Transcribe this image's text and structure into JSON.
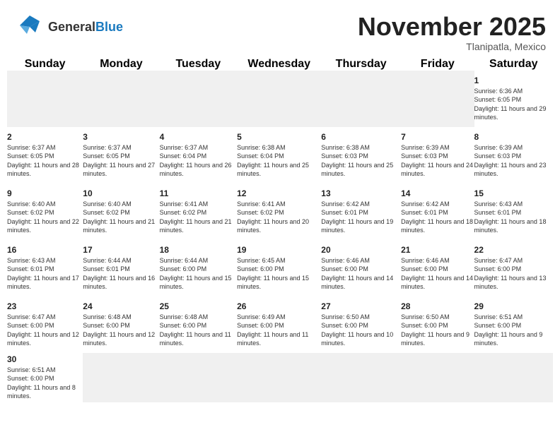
{
  "header": {
    "logo_text_general": "General",
    "logo_text_blue": "Blue",
    "month_title": "November 2025",
    "location": "Tlanipatla, Mexico"
  },
  "days_of_week": [
    "Sunday",
    "Monday",
    "Tuesday",
    "Wednesday",
    "Thursday",
    "Friday",
    "Saturday"
  ],
  "weeks": [
    [
      {
        "day": "",
        "empty": true
      },
      {
        "day": "",
        "empty": true
      },
      {
        "day": "",
        "empty": true
      },
      {
        "day": "",
        "empty": true
      },
      {
        "day": "",
        "empty": true
      },
      {
        "day": "",
        "empty": true
      },
      {
        "day": "1",
        "sunrise": "6:36 AM",
        "sunset": "6:05 PM",
        "daylight": "11 hours and 29 minutes."
      }
    ],
    [
      {
        "day": "2",
        "sunrise": "6:37 AM",
        "sunset": "6:05 PM",
        "daylight": "11 hours and 28 minutes."
      },
      {
        "day": "3",
        "sunrise": "6:37 AM",
        "sunset": "6:05 PM",
        "daylight": "11 hours and 27 minutes."
      },
      {
        "day": "4",
        "sunrise": "6:37 AM",
        "sunset": "6:04 PM",
        "daylight": "11 hours and 26 minutes."
      },
      {
        "day": "5",
        "sunrise": "6:38 AM",
        "sunset": "6:04 PM",
        "daylight": "11 hours and 25 minutes."
      },
      {
        "day": "6",
        "sunrise": "6:38 AM",
        "sunset": "6:03 PM",
        "daylight": "11 hours and 25 minutes."
      },
      {
        "day": "7",
        "sunrise": "6:39 AM",
        "sunset": "6:03 PM",
        "daylight": "11 hours and 24 minutes."
      },
      {
        "day": "8",
        "sunrise": "6:39 AM",
        "sunset": "6:03 PM",
        "daylight": "11 hours and 23 minutes."
      }
    ],
    [
      {
        "day": "9",
        "sunrise": "6:40 AM",
        "sunset": "6:02 PM",
        "daylight": "11 hours and 22 minutes."
      },
      {
        "day": "10",
        "sunrise": "6:40 AM",
        "sunset": "6:02 PM",
        "daylight": "11 hours and 21 minutes."
      },
      {
        "day": "11",
        "sunrise": "6:41 AM",
        "sunset": "6:02 PM",
        "daylight": "11 hours and 21 minutes."
      },
      {
        "day": "12",
        "sunrise": "6:41 AM",
        "sunset": "6:02 PM",
        "daylight": "11 hours and 20 minutes."
      },
      {
        "day": "13",
        "sunrise": "6:42 AM",
        "sunset": "6:01 PM",
        "daylight": "11 hours and 19 minutes."
      },
      {
        "day": "14",
        "sunrise": "6:42 AM",
        "sunset": "6:01 PM",
        "daylight": "11 hours and 18 minutes."
      },
      {
        "day": "15",
        "sunrise": "6:43 AM",
        "sunset": "6:01 PM",
        "daylight": "11 hours and 18 minutes."
      }
    ],
    [
      {
        "day": "16",
        "sunrise": "6:43 AM",
        "sunset": "6:01 PM",
        "daylight": "11 hours and 17 minutes."
      },
      {
        "day": "17",
        "sunrise": "6:44 AM",
        "sunset": "6:01 PM",
        "daylight": "11 hours and 16 minutes."
      },
      {
        "day": "18",
        "sunrise": "6:44 AM",
        "sunset": "6:00 PM",
        "daylight": "11 hours and 15 minutes."
      },
      {
        "day": "19",
        "sunrise": "6:45 AM",
        "sunset": "6:00 PM",
        "daylight": "11 hours and 15 minutes."
      },
      {
        "day": "20",
        "sunrise": "6:46 AM",
        "sunset": "6:00 PM",
        "daylight": "11 hours and 14 minutes."
      },
      {
        "day": "21",
        "sunrise": "6:46 AM",
        "sunset": "6:00 PM",
        "daylight": "11 hours and 14 minutes."
      },
      {
        "day": "22",
        "sunrise": "6:47 AM",
        "sunset": "6:00 PM",
        "daylight": "11 hours and 13 minutes."
      }
    ],
    [
      {
        "day": "23",
        "sunrise": "6:47 AM",
        "sunset": "6:00 PM",
        "daylight": "11 hours and 12 minutes."
      },
      {
        "day": "24",
        "sunrise": "6:48 AM",
        "sunset": "6:00 PM",
        "daylight": "11 hours and 12 minutes."
      },
      {
        "day": "25",
        "sunrise": "6:48 AM",
        "sunset": "6:00 PM",
        "daylight": "11 hours and 11 minutes."
      },
      {
        "day": "26",
        "sunrise": "6:49 AM",
        "sunset": "6:00 PM",
        "daylight": "11 hours and 11 minutes."
      },
      {
        "day": "27",
        "sunrise": "6:50 AM",
        "sunset": "6:00 PM",
        "daylight": "11 hours and 10 minutes."
      },
      {
        "day": "28",
        "sunrise": "6:50 AM",
        "sunset": "6:00 PM",
        "daylight": "11 hours and 9 minutes."
      },
      {
        "day": "29",
        "sunrise": "6:51 AM",
        "sunset": "6:00 PM",
        "daylight": "11 hours and 9 minutes."
      }
    ],
    [
      {
        "day": "30",
        "sunrise": "6:51 AM",
        "sunset": "6:00 PM",
        "daylight": "11 hours and 8 minutes."
      },
      {
        "day": "",
        "empty": true
      },
      {
        "day": "",
        "empty": true
      },
      {
        "day": "",
        "empty": true
      },
      {
        "day": "",
        "empty": true
      },
      {
        "day": "",
        "empty": true
      },
      {
        "day": "",
        "empty": true
      }
    ]
  ]
}
